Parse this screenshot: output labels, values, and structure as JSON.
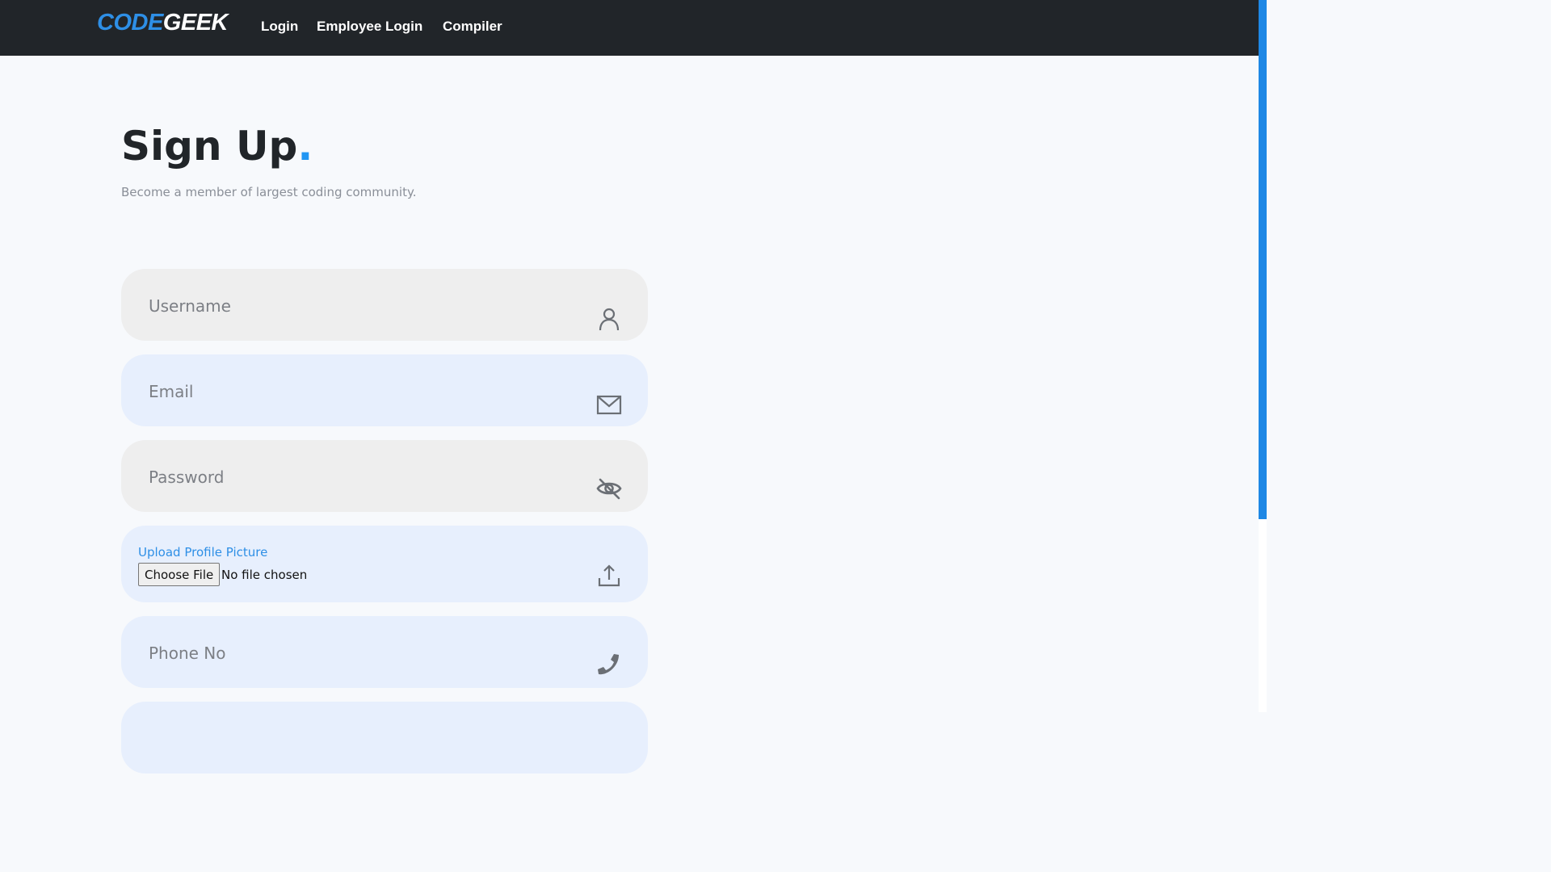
{
  "navbar": {
    "brand_part1": "CODE",
    "brand_part2": "GEEK",
    "links": [
      "Login",
      "Employee Login",
      "Compiler"
    ]
  },
  "header": {
    "title": "Sign Up",
    "title_dot": ".",
    "subtitle": "Become a member of largest coding community."
  },
  "form": {
    "username_placeholder": "Username",
    "email_placeholder": "Email",
    "password_placeholder": "Password",
    "upload_label": "Upload Profile Picture",
    "choose_file_label": "Choose File",
    "file_status": "No file chosen",
    "phone_placeholder": "Phone No"
  },
  "icons": {
    "username": "user-icon",
    "email": "envelope-icon",
    "password": "eye-slash-icon",
    "upload": "upload-icon",
    "phone": "phone-icon"
  },
  "colors": {
    "navbar_bg": "#212529",
    "accent": "#2196f3",
    "field_grey": "#eeeeee",
    "field_blue": "#e7effd"
  }
}
